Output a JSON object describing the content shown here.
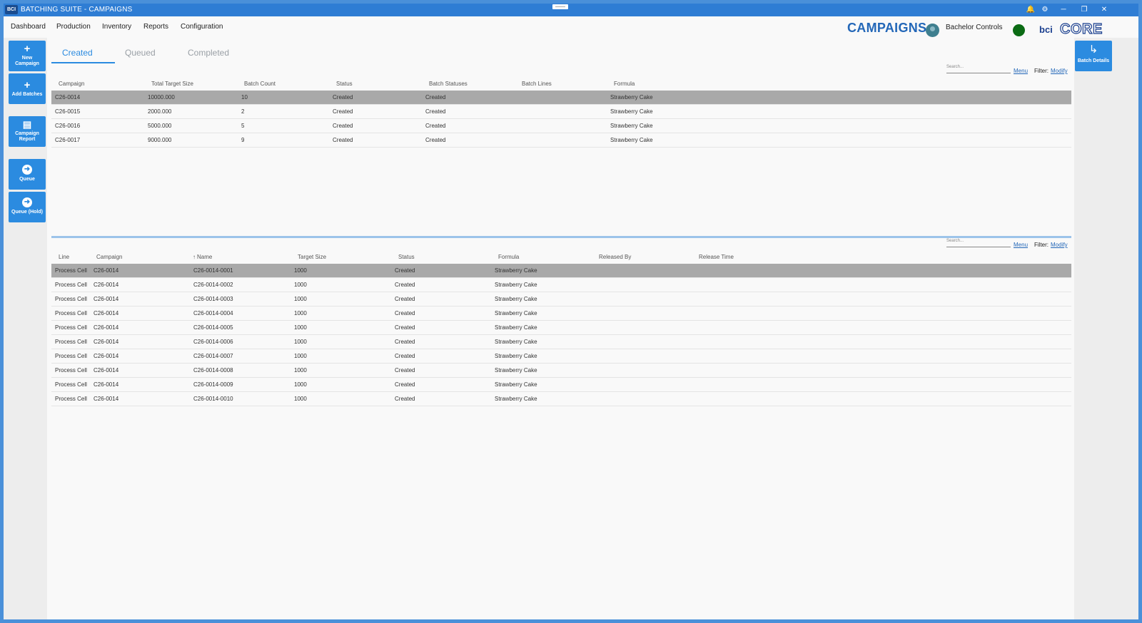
{
  "app": {
    "title": "BATCHING SUITE - CAMPAIGNS",
    "logo_text": "BCI"
  },
  "window_controls": {
    "bell": "🔔",
    "gear": "⚙",
    "minimize": "─",
    "restore": "❐",
    "close": "✕"
  },
  "menu": [
    "Dashboard",
    "Production",
    "Inventory",
    "Reports",
    "Configuration"
  ],
  "header": {
    "page_title": "CAMPAIGNS",
    "user": "Bachelor Controls",
    "status_color": "#0b6b14",
    "brand_prefix": "bci",
    "brand_suffix": "CORE"
  },
  "left_actions": [
    {
      "icon": "+",
      "label": "New Campaign"
    },
    {
      "icon": "+",
      "label": "Add Batches"
    },
    {
      "icon": "▤",
      "label": "Campaign Report"
    },
    {
      "icon": "➜",
      "label": "Queue"
    },
    {
      "icon": "➜",
      "label": "Queue (Hold)"
    }
  ],
  "right_actions": {
    "batch_details": {
      "icon": "↳",
      "label": "Batch Details"
    }
  },
  "tabs": [
    "Created",
    "Queued",
    "Completed"
  ],
  "active_tab": "Created",
  "toolbar": {
    "search_placeholder": "Search...",
    "menu": "Menu",
    "filter_label": "Filter:",
    "filter_link": "Modify"
  },
  "campaigns": {
    "columns": [
      "Campaign",
      "Total Target Size",
      "Batch Count",
      "Status",
      "Batch Statuses",
      "Batch Lines",
      "Formula"
    ],
    "rows": [
      [
        "C26-0014",
        "10000.000",
        "10",
        "Created",
        "Created",
        "",
        "Strawberry Cake"
      ],
      [
        "C26-0015",
        "2000.000",
        "2",
        "Created",
        "Created",
        "",
        "Strawberry Cake"
      ],
      [
        "C26-0016",
        "5000.000",
        "5",
        "Created",
        "Created",
        "",
        "Strawberry Cake"
      ],
      [
        "C26-0017",
        "9000.000",
        "9",
        "Created",
        "Created",
        "",
        "Strawberry Cake"
      ]
    ]
  },
  "batches": {
    "columns": [
      "Line",
      "Campaign",
      "Name",
      "Target Size",
      "Status",
      "Formula",
      "Released By",
      "Release Time"
    ],
    "sort_indicator": "↑",
    "rows": [
      [
        "Process Cell",
        "C26-0014",
        "C26-0014-0001",
        "1000",
        "Created",
        "Strawberry Cake",
        "",
        ""
      ],
      [
        "Process Cell",
        "C26-0014",
        "C26-0014-0002",
        "1000",
        "Created",
        "Strawberry Cake",
        "",
        ""
      ],
      [
        "Process Cell",
        "C26-0014",
        "C26-0014-0003",
        "1000",
        "Created",
        "Strawberry Cake",
        "",
        ""
      ],
      [
        "Process Cell",
        "C26-0014",
        "C26-0014-0004",
        "1000",
        "Created",
        "Strawberry Cake",
        "",
        ""
      ],
      [
        "Process Cell",
        "C26-0014",
        "C26-0014-0005",
        "1000",
        "Created",
        "Strawberry Cake",
        "",
        ""
      ],
      [
        "Process Cell",
        "C26-0014",
        "C26-0014-0006",
        "1000",
        "Created",
        "Strawberry Cake",
        "",
        ""
      ],
      [
        "Process Cell",
        "C26-0014",
        "C26-0014-0007",
        "1000",
        "Created",
        "Strawberry Cake",
        "",
        ""
      ],
      [
        "Process Cell",
        "C26-0014",
        "C26-0014-0008",
        "1000",
        "Created",
        "Strawberry Cake",
        "",
        ""
      ],
      [
        "Process Cell",
        "C26-0014",
        "C26-0014-0009",
        "1000",
        "Created",
        "Strawberry Cake",
        "",
        ""
      ],
      [
        "Process Cell",
        "C26-0014",
        "C26-0014-0010",
        "1000",
        "Created",
        "Strawberry Cake",
        "",
        ""
      ]
    ]
  }
}
